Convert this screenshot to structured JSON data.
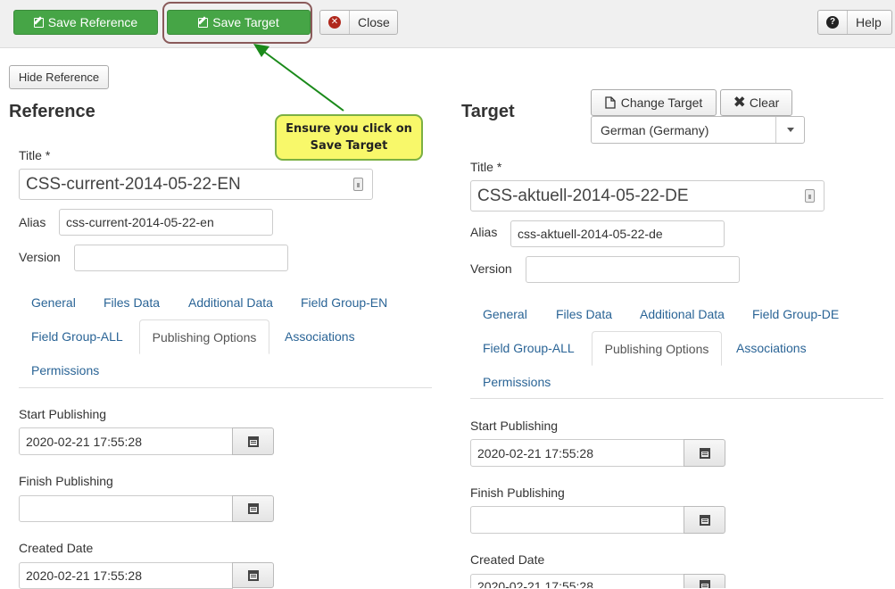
{
  "toolbar": {
    "save_reference": "Save Reference",
    "save_target": "Save Target",
    "close": "Close",
    "help": "Help"
  },
  "annotation": {
    "callout_line1": "Ensure you click on",
    "callout_line2": "Save Target",
    "arrow_color": "#1a8a1a"
  },
  "reference": {
    "hide_button": "Hide Reference",
    "heading": "Reference",
    "title_label": "Title *",
    "title_value": "CSS-current-2014-05-22-EN",
    "alias_label": "Alias",
    "alias_value": "css-current-2014-05-22-en",
    "version_label": "Version",
    "version_value": "",
    "tabs": [
      "General",
      "Files Data",
      "Additional Data",
      "Field Group-EN",
      "Field Group-ALL",
      "Publishing Options",
      "Associations",
      "Permissions"
    ],
    "active_tab": "Publishing Options",
    "start_label": "Start Publishing",
    "start_value": "2020-02-21 17:55:28",
    "finish_label": "Finish Publishing",
    "finish_value": "",
    "created_label": "Created Date",
    "created_value": "2020-02-21 17:55:28"
  },
  "target": {
    "heading": "Target",
    "change_target": "Change Target",
    "clear": "Clear",
    "language": "German (Germany)",
    "title_label": "Title *",
    "title_value": "CSS-aktuell-2014-05-22-DE",
    "alias_label": "Alias",
    "alias_value": "css-aktuell-2014-05-22-de",
    "version_label": "Version",
    "version_value": "",
    "tabs": [
      "General",
      "Files Data",
      "Additional Data",
      "Field Group-DE",
      "Field Group-ALL",
      "Publishing Options",
      "Associations",
      "Permissions"
    ],
    "active_tab": "Publishing Options",
    "start_label": "Start Publishing",
    "start_value": "2020-02-21 17:55:28",
    "finish_label": "Finish Publishing",
    "finish_value": "",
    "created_label": "Created Date",
    "created_value": "2020-02-21 17:55:28"
  },
  "colors": {
    "success": "#46a546",
    "link": "#2a6496",
    "callout_bg": "#f8f86a",
    "callout_border": "#7bb043"
  }
}
